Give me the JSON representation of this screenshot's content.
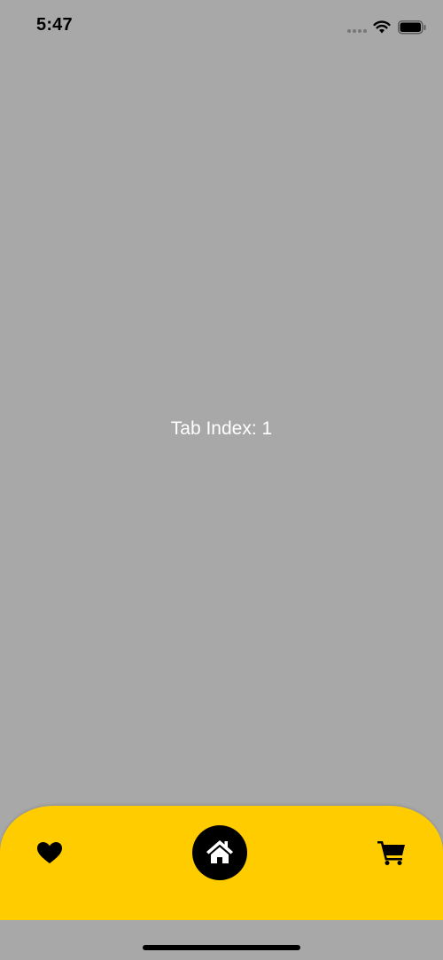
{
  "status_bar": {
    "time": "5:47"
  },
  "content": {
    "label": "Tab Index: 1"
  },
  "bottom_nav": {
    "selected_index": 1,
    "items": [
      {
        "icon": "heart-icon"
      },
      {
        "icon": "home-icon"
      },
      {
        "icon": "cart-icon"
      }
    ]
  },
  "colors": {
    "background": "#a8a8a8",
    "nav_background": "#ffcc00",
    "active_circle": "#000000",
    "label_text": "#ffffff"
  }
}
